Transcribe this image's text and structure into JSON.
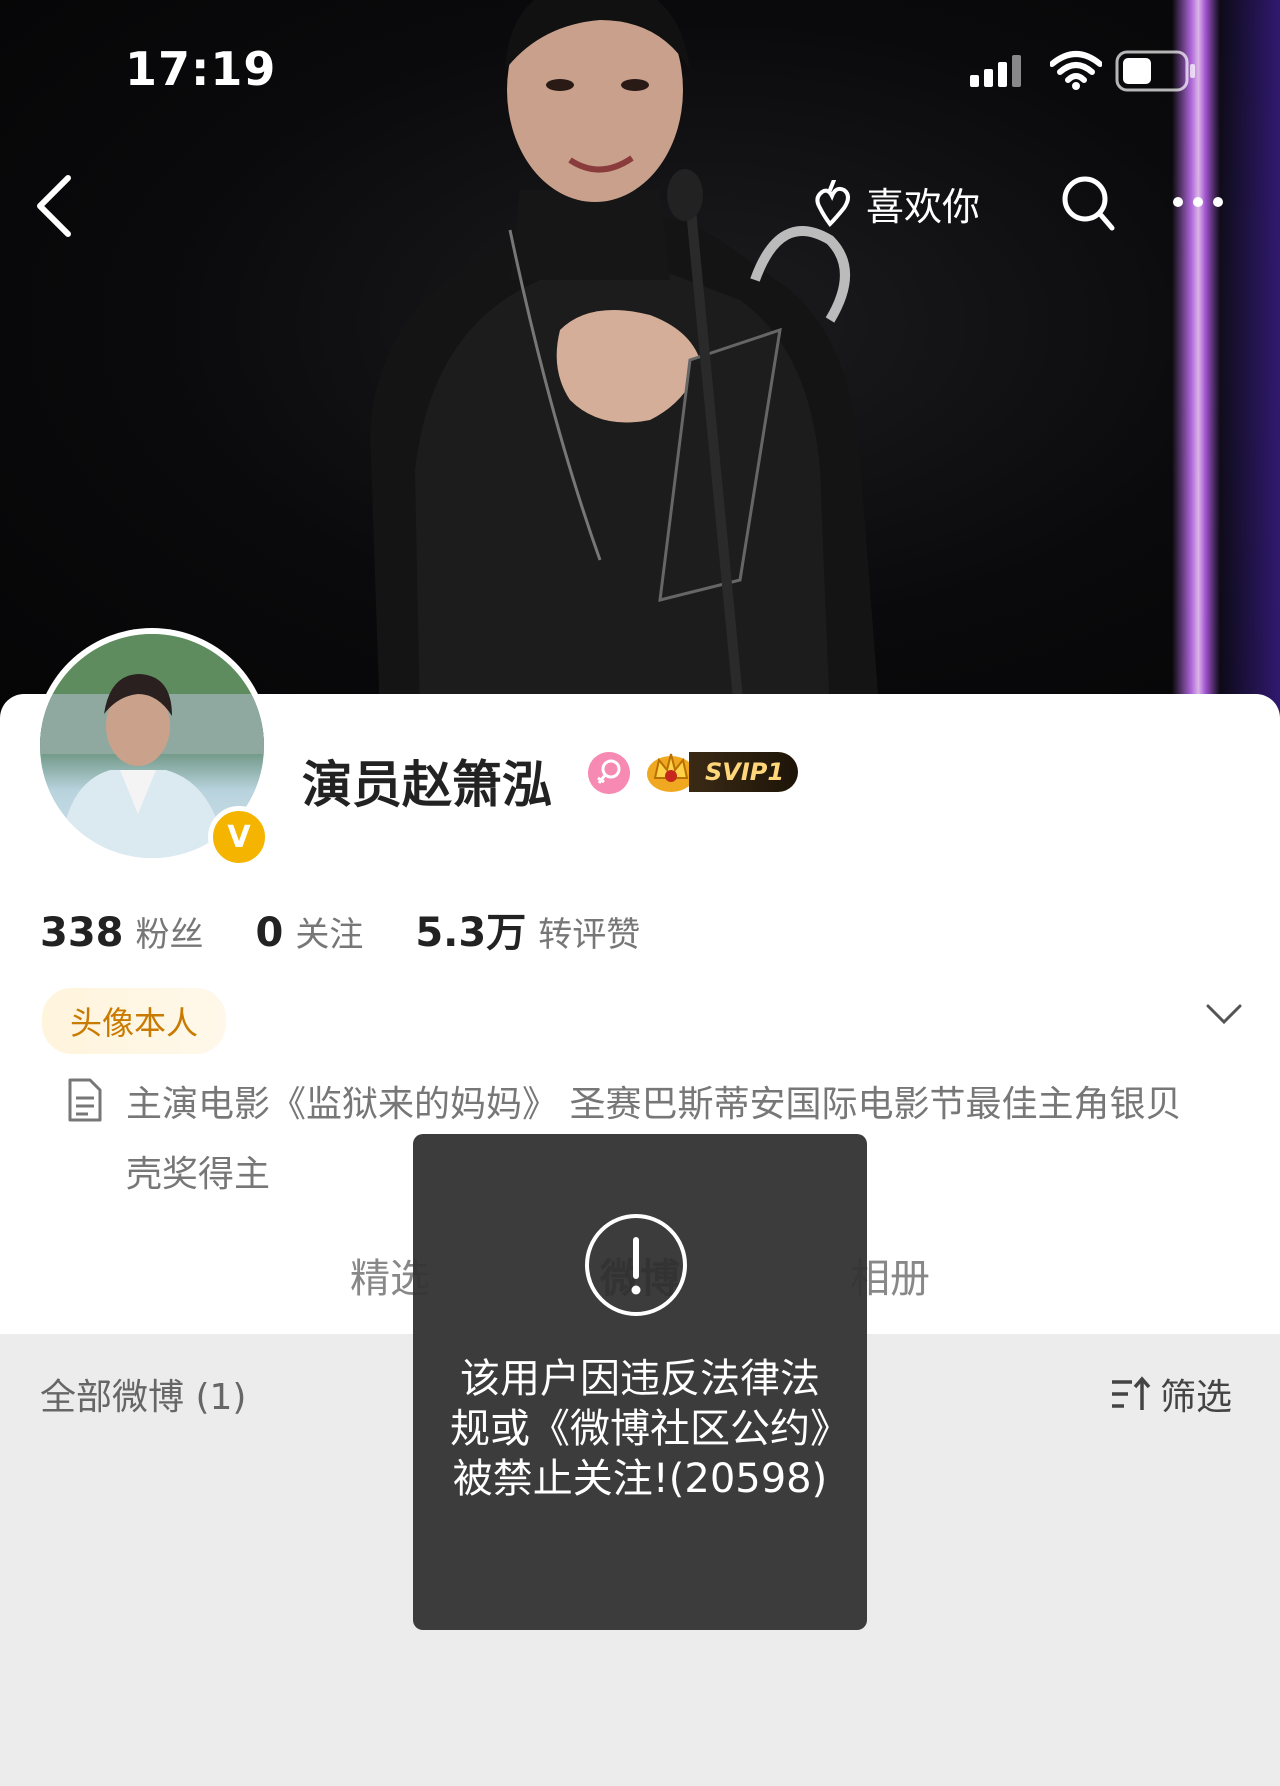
{
  "status_bar": {
    "time": "17:19"
  },
  "nav": {
    "like_label": "喜欢你"
  },
  "profile": {
    "name": "演员赵箫泓",
    "svip_label": "SVIP1",
    "verified_mark": "V",
    "stats": [
      {
        "value": "338",
        "label": "粉丝"
      },
      {
        "value": "0",
        "label": "关注"
      },
      {
        "value": "5.3万",
        "label": "转评赞"
      }
    ],
    "tag": "头像本人",
    "bio": "主演电影《监狱来的妈妈》 圣赛巴斯蒂安国际电影节最佳主角银贝壳奖得主"
  },
  "tabs": [
    {
      "label": "精选"
    },
    {
      "label": "微博"
    },
    {
      "label": "相册"
    }
  ],
  "feed": {
    "all_posts": "全部微博 (1)",
    "filter_label": "筛选"
  },
  "toast": {
    "message": "该用户因违反法律法规或《微博社区公约》被禁止关注!(20598)"
  },
  "colors": {
    "accent_orange": "#f5b400",
    "tag_text": "#c97a00",
    "toast_bg": "#343434"
  }
}
